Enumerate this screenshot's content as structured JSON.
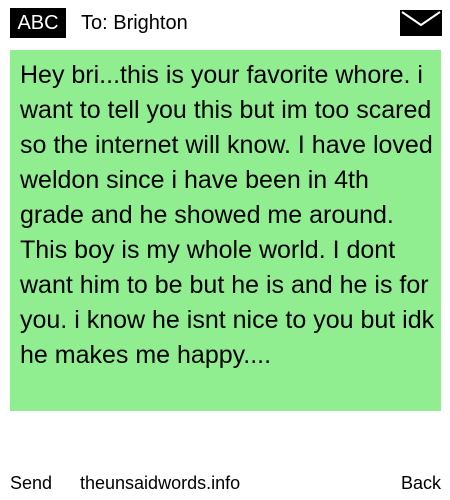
{
  "header": {
    "badge": "ABC",
    "recipient_label": "To: Brighton",
    "envelope_icon": "envelope-icon"
  },
  "message": {
    "text": "Hey bri...this is your favorite whore. i want to tell you this but im too scared so the internet will know. I have loved weldon since i have been in 4th grade and he showed me around. This boy is my whole world. I dont want him to be but he is and he is for you. i know he isnt nice to you but idk he makes me happy....",
    "background_color": "#90ee90"
  },
  "footer": {
    "send_label": "Send",
    "site_label": "theunsaidwords.info",
    "back_label": "Back"
  }
}
